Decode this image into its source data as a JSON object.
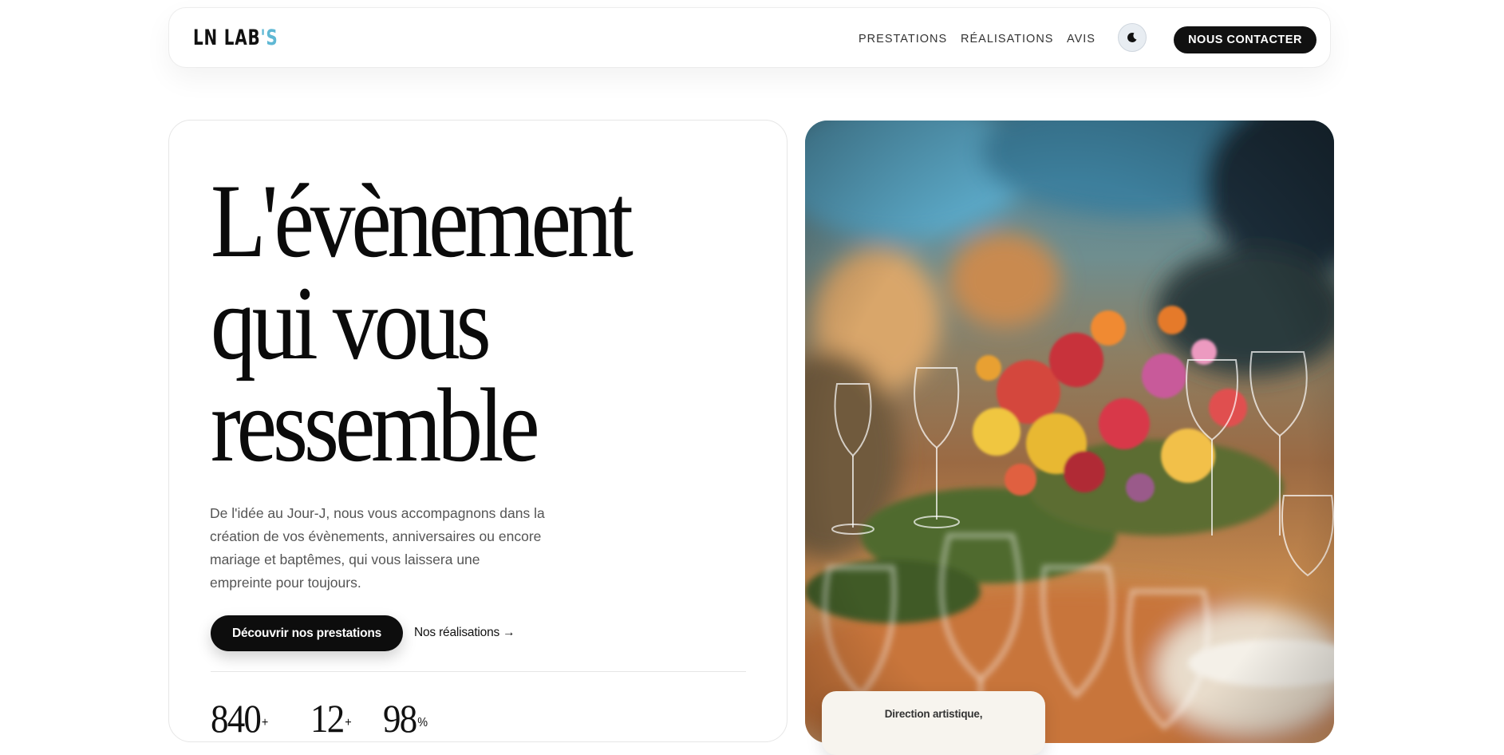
{
  "header": {
    "logo_main": "LN LAB",
    "logo_accent": "'S",
    "nav": [
      "PRESTATIONS",
      "RÉALISATIONS",
      "AVIS"
    ],
    "theme_icon": "moon-icon",
    "contact_label": "NOUS CONTACTER"
  },
  "hero": {
    "title_lines": [
      "L'évènement",
      "qui vous",
      "ressemble"
    ],
    "subtitle": "De l'idée au Jour-J, nous vous accompagnons dans la création de vos évènements, anniversaires ou encore mariage et baptêmes, qui vous laissera une empreinte pour toujours.",
    "primary_button": "Découvrir nos prestations",
    "secondary_link": "Nos réalisations →",
    "stats": [
      {
        "value": "840",
        "suffix": "+"
      },
      {
        "value": "12",
        "suffix": "+"
      },
      {
        "value": "98",
        "suffix": "%"
      }
    ]
  },
  "photo": {
    "caption": "Direction artistique,"
  },
  "colors": {
    "accent": "#5fb8d4",
    "button_dark": "#0d0d0d",
    "toggle_bg": "#e8edf2"
  }
}
